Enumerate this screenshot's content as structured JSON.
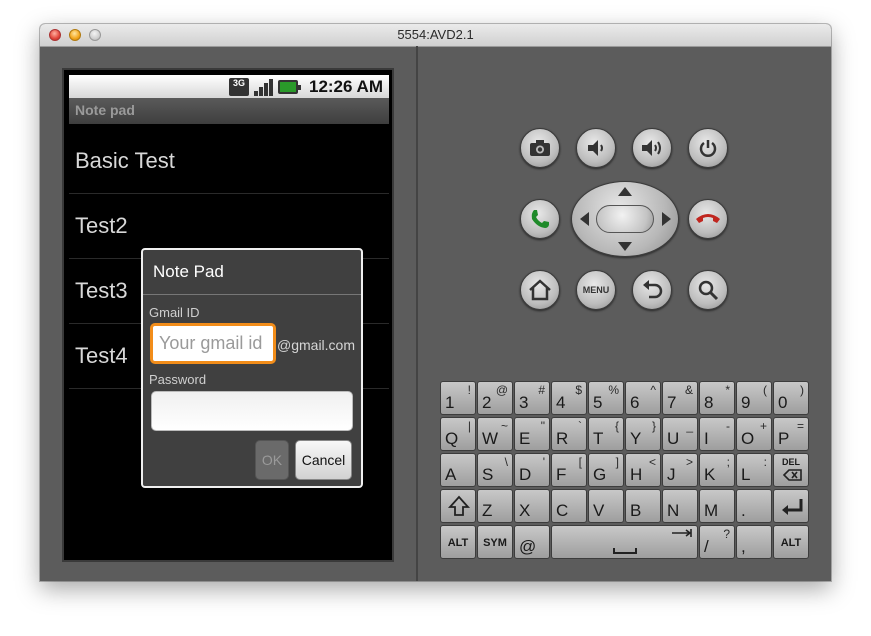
{
  "window": {
    "title": "5554:AVD2.1"
  },
  "status_bar": {
    "network": "3G",
    "time": "12:26 AM"
  },
  "app": {
    "title": "Note pad"
  },
  "notes": [
    {
      "label": "Basic Test"
    },
    {
      "label": "Test2"
    },
    {
      "label": "Test3"
    },
    {
      "label": "Test4"
    }
  ],
  "dialog": {
    "title": "Note Pad",
    "gmail_label": "Gmail ID",
    "gmail_placeholder": "Your gmail id",
    "gmail_suffix": "@gmail.com",
    "password_label": "Password",
    "ok_label": "OK",
    "cancel_label": "Cancel"
  },
  "controls": {
    "menu_label": "MENU",
    "icons": [
      "camera-icon",
      "volume-down-icon",
      "volume-up-icon",
      "power-icon",
      "call-icon",
      "end-call-icon",
      "home-icon",
      "back-icon",
      "search-icon"
    ]
  },
  "keyboard": {
    "rows": [
      [
        {
          "main": "1",
          "alt": "!"
        },
        {
          "main": "2",
          "alt": "@"
        },
        {
          "main": "3",
          "alt": "#"
        },
        {
          "main": "4",
          "alt": "$"
        },
        {
          "main": "5",
          "alt": "%"
        },
        {
          "main": "6",
          "alt": "^"
        },
        {
          "main": "7",
          "alt": "&"
        },
        {
          "main": "8",
          "alt": "*"
        },
        {
          "main": "9",
          "alt": "("
        },
        {
          "main": "0",
          "alt": ")"
        }
      ],
      [
        {
          "main": "Q",
          "alt": "|"
        },
        {
          "main": "W",
          "alt": "~"
        },
        {
          "main": "E",
          "alt": "\""
        },
        {
          "main": "R",
          "alt": "`"
        },
        {
          "main": "T",
          "alt": "{"
        },
        {
          "main": "Y",
          "alt": "}"
        },
        {
          "main": "U",
          "alt": "_"
        },
        {
          "main": "I",
          "alt": "-"
        },
        {
          "main": "O",
          "alt": "+"
        },
        {
          "main": "P",
          "alt": "="
        }
      ],
      [
        {
          "main": "A",
          "alt": ""
        },
        {
          "main": "S",
          "alt": "\\"
        },
        {
          "main": "D",
          "alt": "'"
        },
        {
          "main": "F",
          "alt": "["
        },
        {
          "main": "G",
          "alt": "]"
        },
        {
          "main": "H",
          "alt": "<"
        },
        {
          "main": "J",
          "alt": ">"
        },
        {
          "main": "K",
          "alt": ";"
        },
        {
          "main": "L",
          "alt": ":"
        },
        {
          "special": "DEL"
        }
      ],
      [
        {
          "special": "shift"
        },
        {
          "main": "Z",
          "alt": ""
        },
        {
          "main": "X",
          "alt": ""
        },
        {
          "main": "C",
          "alt": ""
        },
        {
          "main": "V",
          "alt": ""
        },
        {
          "main": "B",
          "alt": ""
        },
        {
          "main": "N",
          "alt": ""
        },
        {
          "main": "M",
          "alt": ""
        },
        {
          "main": ".",
          "alt": ""
        },
        {
          "special": "enter"
        }
      ],
      [
        {
          "special": "ALT"
        },
        {
          "special": "SYM"
        },
        {
          "main": "@",
          "alt": ""
        },
        {
          "special": "space"
        },
        {
          "main": "/",
          "alt": "?"
        },
        {
          "main": ",",
          "alt": ""
        },
        {
          "special": "ALT2"
        }
      ]
    ],
    "alt_label": "ALT",
    "sym_label": "SYM",
    "del_label": "DEL"
  }
}
